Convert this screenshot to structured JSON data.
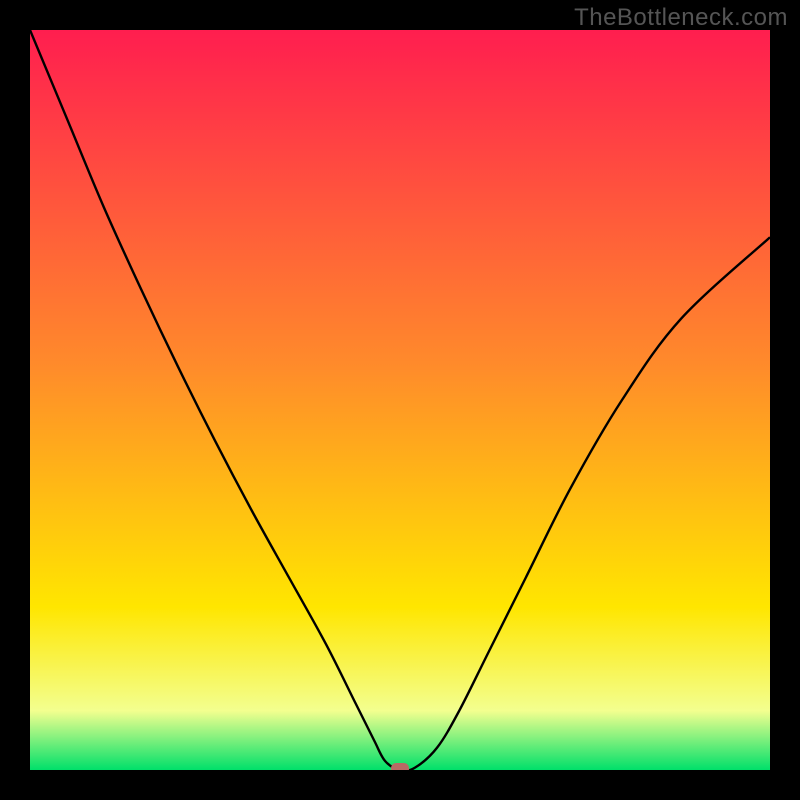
{
  "watermark": "TheBottleneck.com",
  "colors": {
    "frame": "#000000",
    "grad_top": "#ff1e4f",
    "grad_mid1": "#ff8a2b",
    "grad_mid2": "#ffe600",
    "grad_mid3": "#f3ff8f",
    "grad_bottom": "#00e06a",
    "curve": "#000000",
    "marker": "#b76a64"
  },
  "chart_data": {
    "type": "line",
    "title": "",
    "xlabel": "",
    "ylabel": "",
    "xlim": [
      0,
      100
    ],
    "ylim": [
      0,
      100
    ],
    "annotations": [
      {
        "name": "optimum-marker",
        "x": 50,
        "y": 0
      }
    ],
    "series": [
      {
        "name": "bottleneck-curve",
        "x": [
          0,
          5,
          10,
          15,
          20,
          25,
          30,
          35,
          40,
          44,
          46.5,
          48,
          50,
          52,
          55,
          58,
          62,
          67,
          73,
          80,
          88,
          100
        ],
        "y": [
          100,
          88,
          76,
          65,
          54.5,
          44.5,
          35,
          26,
          17,
          9,
          4,
          1.2,
          0,
          0.3,
          3,
          8,
          16,
          26,
          38,
          50,
          61,
          72
        ]
      }
    ]
  }
}
